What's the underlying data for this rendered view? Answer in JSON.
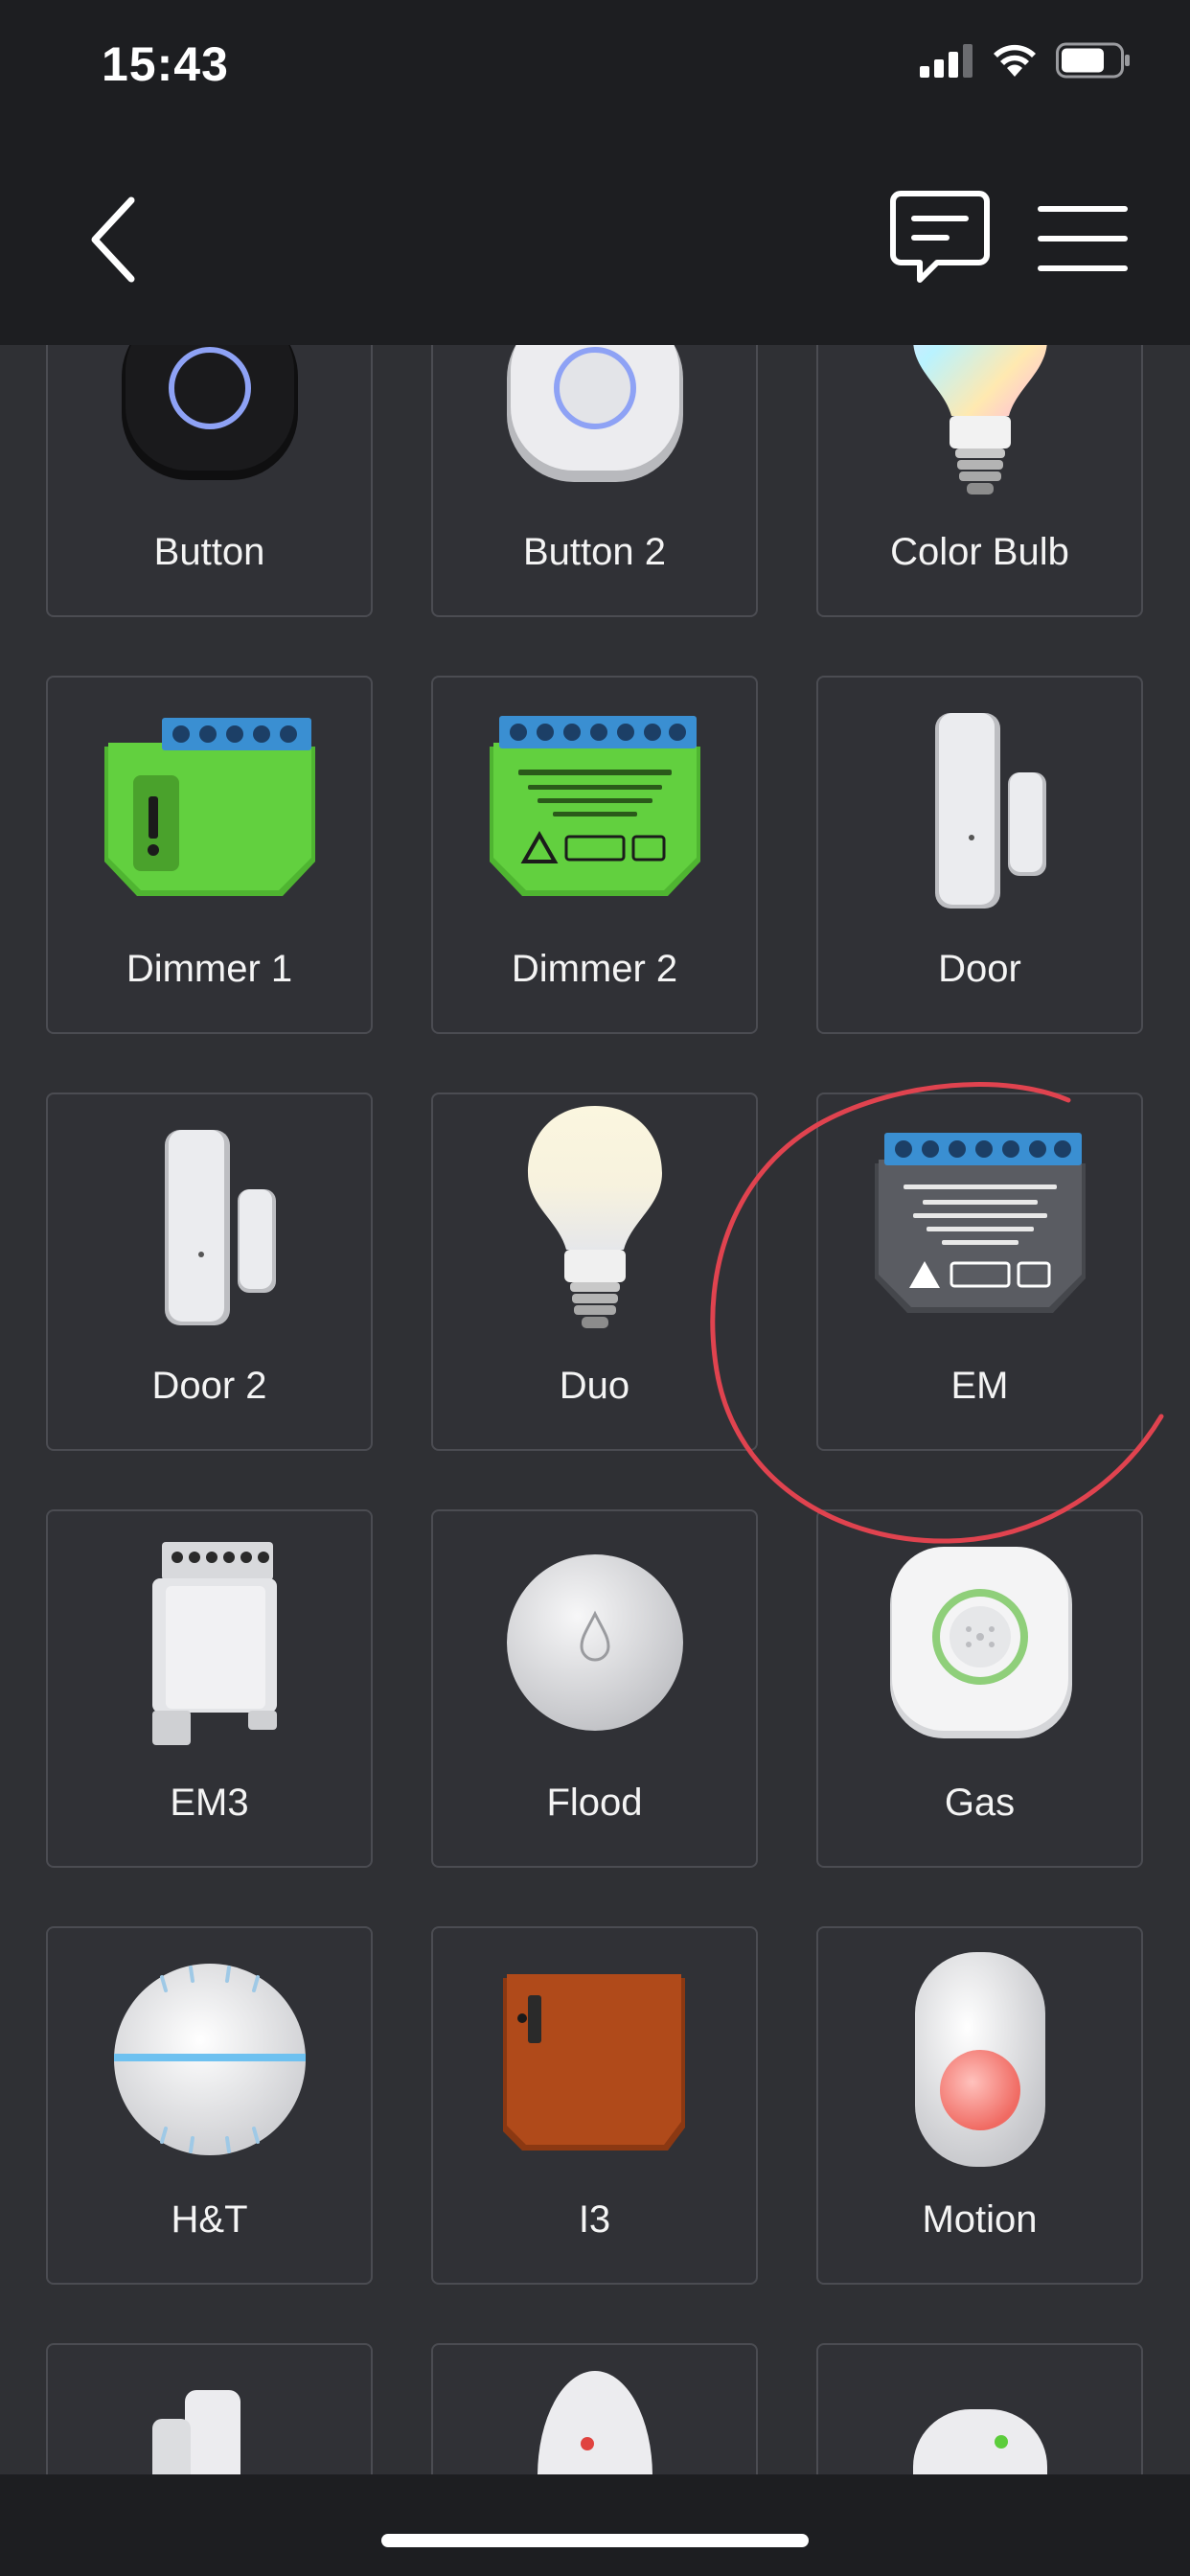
{
  "status_bar": {
    "time": "15:43"
  },
  "nav": {
    "back_icon": "chevron-left-icon",
    "chat_icon": "chat-bubble-icon",
    "menu_icon": "hamburger-menu-icon"
  },
  "colors": {
    "background": "#1d1e21",
    "content_bg": "#2f3034",
    "tile_border": "#4b4c52",
    "annotation_red": "#e0434f",
    "device_green": "#5ccd3c",
    "terminal_blue": "#3c8fd2"
  },
  "devices": [
    {
      "label": "Button",
      "icon": "button-black-icon"
    },
    {
      "label": "Button 2",
      "icon": "button-white-icon"
    },
    {
      "label": "Color Bulb",
      "icon": "color-bulb-icon"
    },
    {
      "label": "Dimmer 1",
      "icon": "dimmer-green-icon"
    },
    {
      "label": "Dimmer 2",
      "icon": "dimmer2-green-icon"
    },
    {
      "label": "Door",
      "icon": "door-sensor-icon"
    },
    {
      "label": "Door 2",
      "icon": "door-sensor-icon"
    },
    {
      "label": "Duo",
      "icon": "duo-bulb-icon"
    },
    {
      "label": "EM",
      "icon": "em-module-icon"
    },
    {
      "label": "EM3",
      "icon": "em3-din-icon"
    },
    {
      "label": "Flood",
      "icon": "flood-sensor-icon"
    },
    {
      "label": "Gas",
      "icon": "gas-sensor-icon"
    },
    {
      "label": "H&T",
      "icon": "ht-sensor-icon"
    },
    {
      "label": "I3",
      "icon": "i3-module-icon"
    },
    {
      "label": "Motion",
      "icon": "motion-sensor-icon"
    }
  ]
}
